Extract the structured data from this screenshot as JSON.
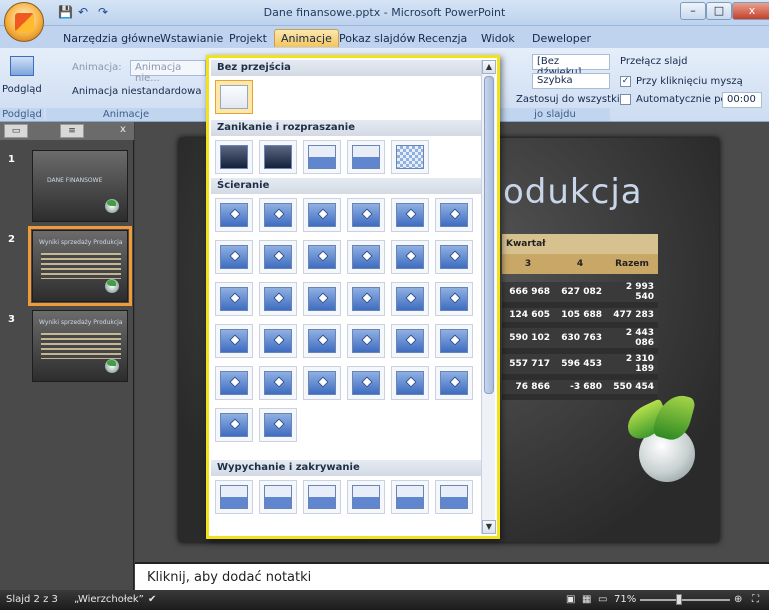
{
  "window": {
    "title": "Dane finansowe.pptx - Microsoft PowerPoint",
    "min": "–",
    "max": "□",
    "close": "x"
  },
  "qat": {
    "save": "💾",
    "undo": "↶",
    "redo": "↷"
  },
  "tabs": [
    "Narzędzia główne",
    "Wstawianie",
    "Projekt",
    "Animacje",
    "Pokaz slajdów",
    "Recenzja",
    "Widok",
    "Deweloper"
  ],
  "active_tab": "Animacje",
  "ribbon": {
    "preview_label": "Podgląd",
    "preview_group": "Podgląd",
    "animation_label": "Animacja:",
    "animation_value": "Animacja nie...",
    "custom_animation": "Animacja niestandardowa",
    "animations_group": "Animacje",
    "sound_value": "[Bez dźwięku]",
    "speed_value": "Szybka",
    "apply_all": "Zastosuj do wszystkich",
    "transition_group_tail": "jo slajdu",
    "advance_title": "Przełącz slajd",
    "on_click": "Przy kliknięciu myszą",
    "on_click_checked": true,
    "auto_after": "Automatycznie po:",
    "auto_time": "00:00"
  },
  "gallery": {
    "sections": [
      {
        "title": "Bez przejścia",
        "count": 1
      },
      {
        "title": "Zanikanie i rozpraszanie",
        "count": 5
      },
      {
        "title": "Ścieranie",
        "count": 32
      },
      {
        "title": "Wypychanie i zakrywanie",
        "count": 6
      }
    ]
  },
  "slides_pane": {
    "slides": [
      {
        "num": "1",
        "title": "DANE FINANSOWE"
      },
      {
        "num": "2",
        "title": "Wyniki sprzedaży Produkcja"
      },
      {
        "num": "3",
        "title": "Wyniki sprzedaży Produkcja"
      }
    ],
    "selected": 1
  },
  "slide": {
    "title_partial": "odukcja",
    "table": {
      "group_header": "Kwartał",
      "headers": [
        "3",
        "4",
        "Razem"
      ],
      "rows": [
        [
          "666 968",
          "627 082",
          "2 993 540"
        ],
        [
          "124 605",
          "105 688",
          "477 283"
        ],
        [
          "590 102",
          "630 763",
          "2 443 086"
        ],
        [
          "557 717",
          "596 453",
          "2 310 189"
        ],
        [
          "76 866",
          "-3 680",
          "550 454"
        ]
      ]
    }
  },
  "notes": {
    "placeholder": "Kliknij, aby dodać notatki"
  },
  "status": {
    "slide_info": "Slajd 2 z 3",
    "theme": "„Wierzchołek”",
    "zoom": "71%"
  },
  "colors": {
    "highlight": "#f2e21b",
    "selected_thumb": "#f09a3a"
  }
}
